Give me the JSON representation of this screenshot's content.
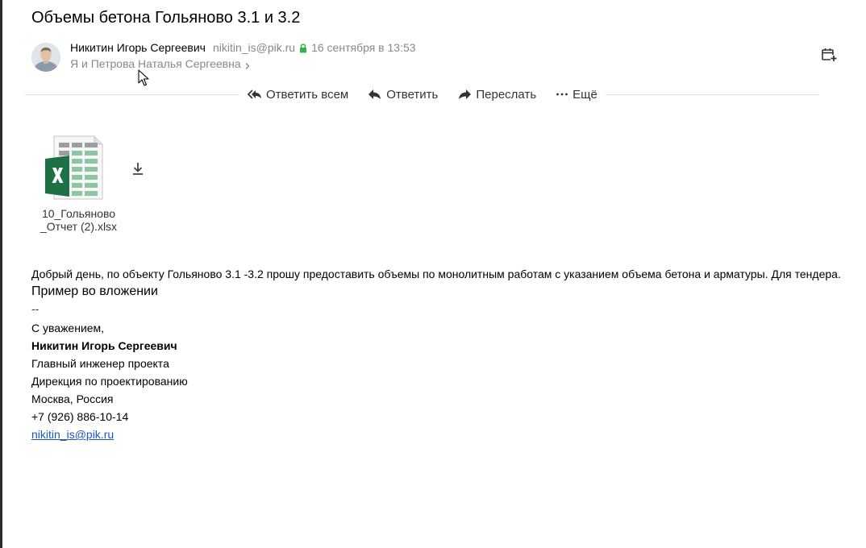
{
  "email": {
    "subject": "Объемы бетона Гольяново 3.1 и 3.2",
    "sender_name": "Никитин Игорь Сергеевич",
    "sender_email": "nikitin_is@pik.ru",
    "date": "16 сентября в 13:53",
    "recipients": "Я и Петрова Наталья Сергеевна"
  },
  "toolbar": {
    "reply_all": "Ответить всем",
    "reply": "Ответить",
    "forward": "Переслать",
    "more": "Ещё"
  },
  "attachment": {
    "name_line1": "10_Гольяново",
    "name_line2": "_Отчет (2).xlsx"
  },
  "body": {
    "paragraph": "Добрый день, по объекту Гольяново 3.1 -3.2 прошу предоставить объемы по монолитным работам с указанием объема бетона и арматуры. Для тендера.",
    "attachment_note": "Пример во вложении",
    "separator": "--",
    "regards": "С уважением,",
    "sig_name": "Никитин Игорь Сергеевич",
    "sig_title": "Главный инженер проекта",
    "sig_dept": "Дирекция по проектированию",
    "sig_city": "Москва, Россия",
    "sig_phone": "+7 (926) 886-10-14",
    "sig_email": "nikitin_is@pik.ru"
  },
  "colors": {
    "excel_green": "#1e7145",
    "link": "#1a56c6",
    "secure_lock": "#2fb24a"
  }
}
